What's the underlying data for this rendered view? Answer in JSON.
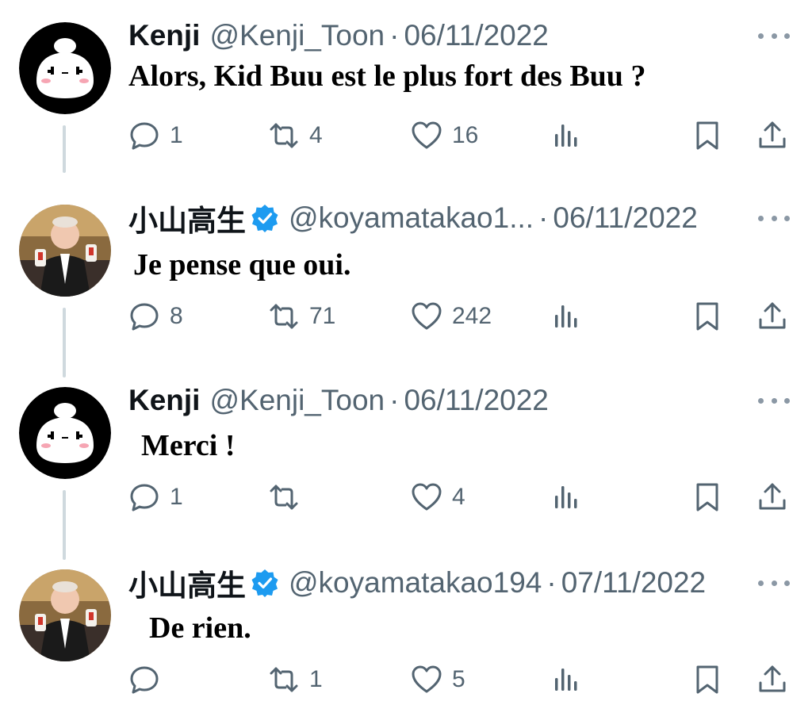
{
  "tweets": [
    {
      "name": "Kenji",
      "verified": false,
      "handle": "@Kenji_Toon",
      "separator": "·",
      "date": "06/11/2022",
      "text": "Alors, Kid Buu est le plus fort des Buu ?",
      "avatar": "cartoon-avatar",
      "replies": "1",
      "retweets": "4",
      "likes": "16"
    },
    {
      "name": "小山高生",
      "verified": true,
      "handle": "@koyamatakao1...",
      "separator": "·",
      "date": "06/11/2022",
      "text": "Je pense que oui.",
      "avatar": "photo-avatar",
      "replies": "8",
      "retweets": "71",
      "likes": "242"
    },
    {
      "name": "Kenji",
      "verified": false,
      "handle": "@Kenji_Toon",
      "separator": "·",
      "date": "06/11/2022",
      "text": "Merci !",
      "avatar": "cartoon-avatar",
      "replies": "1",
      "retweets": "",
      "likes": "4"
    },
    {
      "name": "小山高生",
      "verified": true,
      "handle": "@koyamatakao194",
      "separator": "·",
      "date": "07/11/2022",
      "text": "De rien.",
      "avatar": "photo-avatar",
      "replies": "",
      "retweets": "1",
      "likes": "5"
    }
  ],
  "icons": {
    "reply": "reply-icon",
    "retweet": "retweet-icon",
    "like": "heart-icon",
    "views": "views-icon",
    "bookmark": "bookmark-icon",
    "share": "share-icon",
    "more": "more-icon",
    "verified": "verified-badge-icon"
  },
  "colors": {
    "text": "#0f1419",
    "secondary": "#536471",
    "verified": "#1d9bf0",
    "thread_line": "#cfd9de"
  }
}
